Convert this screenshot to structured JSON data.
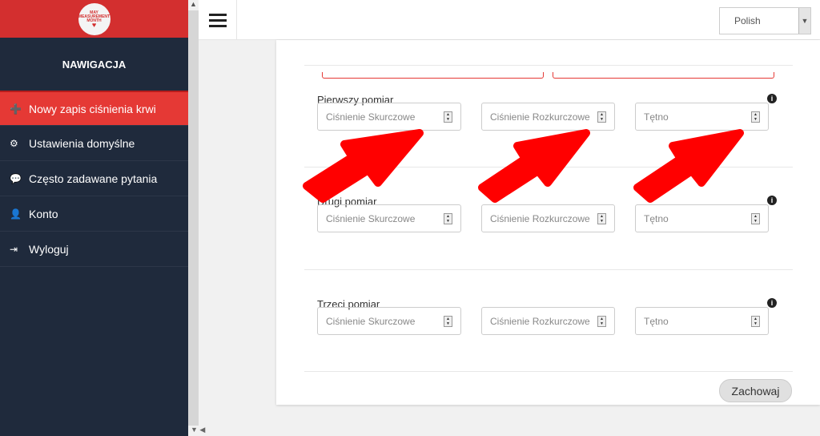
{
  "logo": {
    "text": "MAY MEASUREMENT MONTH"
  },
  "sidebar": {
    "title": "NAWIGACJA",
    "items": [
      {
        "label": "Nowy zapis ciśnienia krwi",
        "icon": "plus-square-icon",
        "active": true
      },
      {
        "label": "Ustawienia domyślne",
        "icon": "gear-icon"
      },
      {
        "label": "Często zadawane pytania",
        "icon": "comment-icon"
      },
      {
        "label": "Konto",
        "icon": "user-icon"
      },
      {
        "label": "Wyloguj",
        "icon": "sign-out-icon"
      }
    ]
  },
  "topbar": {
    "language": "Polish"
  },
  "sections": [
    {
      "label": "Pierwszy pomiar",
      "fields": [
        "Ciśnienie Skurczowe",
        "Ciśnienie Rozkurczowe",
        "Tętno"
      ]
    },
    {
      "label": "Drugi pomiar",
      "fields": [
        "Ciśnienie Skurczowe",
        "Ciśnienie Rozkurczowe",
        "Tętno"
      ]
    },
    {
      "label": "Trzeci pomiar",
      "fields": [
        "Ciśnienie Skurczowe",
        "Ciśnienie Rozkurczowe",
        "Tętno"
      ]
    }
  ],
  "save_label": "Zachowaj",
  "colors": {
    "brand": "#d32f2f",
    "sidebar": "#1f2a3c",
    "annotation_arrow": "#ff0000"
  }
}
